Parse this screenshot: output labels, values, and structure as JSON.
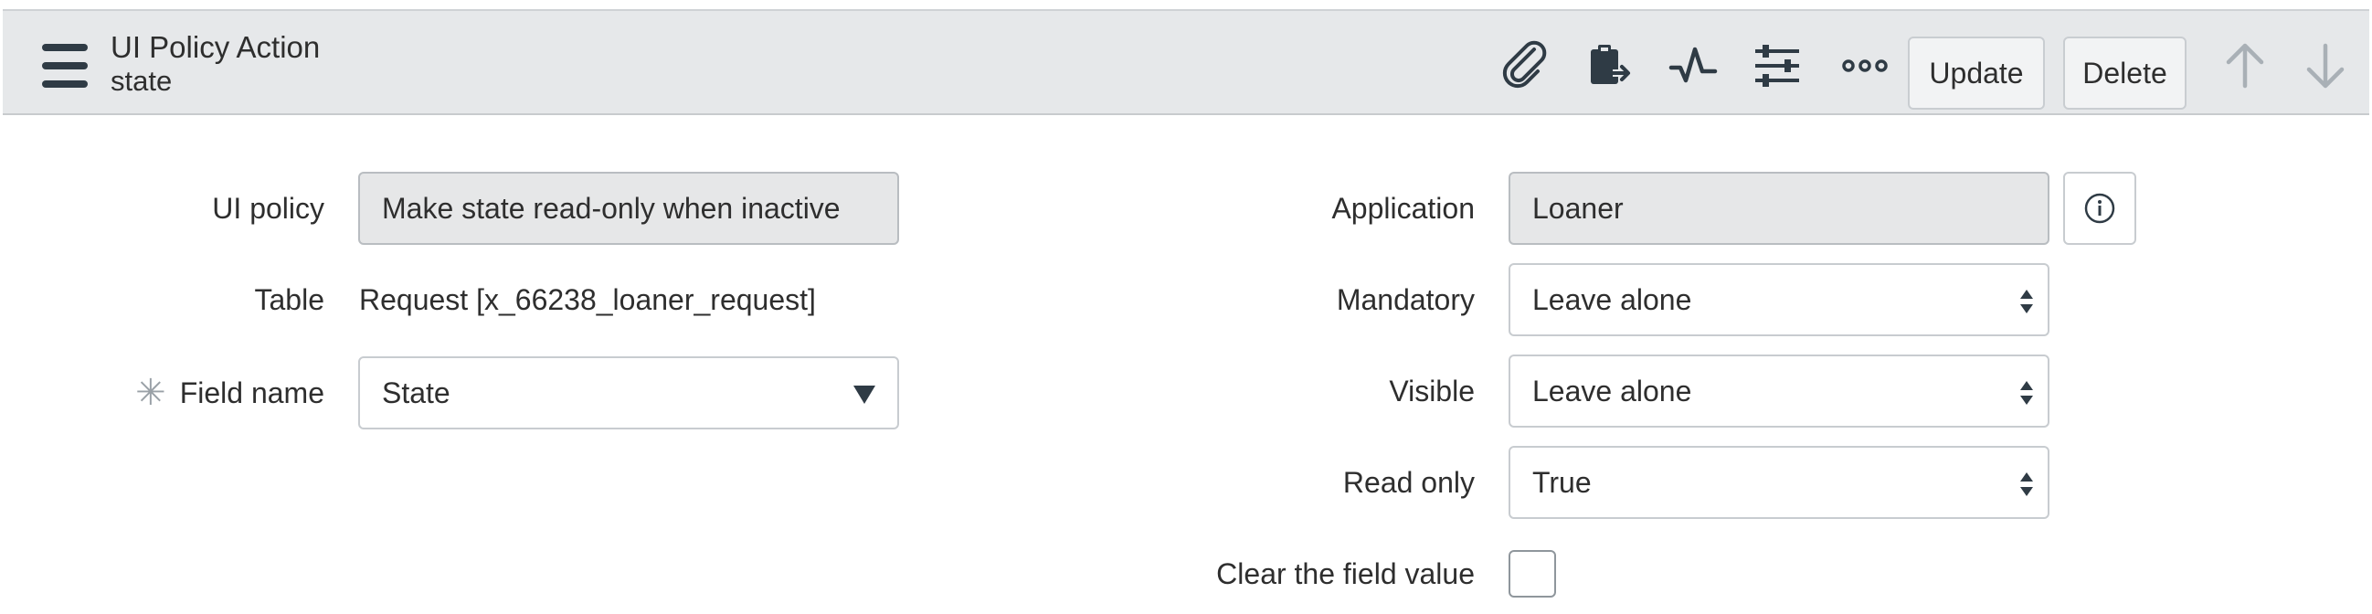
{
  "header": {
    "title": "UI Policy Action",
    "subtitle": "state",
    "icons": [
      "paperclip-icon",
      "clipboard-export-icon",
      "activity-pulse-icon",
      "sliders-icon",
      "more-options-icon"
    ],
    "update_label": "Update",
    "delete_label": "Delete",
    "nav_icons": [
      "arrow-up-icon",
      "arrow-down-icon"
    ]
  },
  "form": {
    "left": {
      "ui_policy": {
        "label": "UI policy",
        "value": "Make state read-only when inactive"
      },
      "table": {
        "label": "Table",
        "value": "Request [x_66238_loaner_request]"
      },
      "field_name": {
        "required_marker": "✳",
        "label": "Field name",
        "value": "State"
      }
    },
    "right": {
      "application": {
        "label": "Application",
        "value": "Loaner"
      },
      "mandatory": {
        "label": "Mandatory",
        "value": "Leave alone"
      },
      "visible": {
        "label": "Visible",
        "value": "Leave alone"
      },
      "read_only": {
        "label": "Read only",
        "value": "True"
      },
      "clear_value": {
        "label": "Clear the field value",
        "checked": false
      }
    }
  },
  "colors": {
    "header_bg": "#e6e8ea",
    "readonly_bg": "#e6e7e8",
    "text": "#2e2e2e",
    "icon": "#2f3b45",
    "disabled_icon": "#a9b0b6"
  }
}
